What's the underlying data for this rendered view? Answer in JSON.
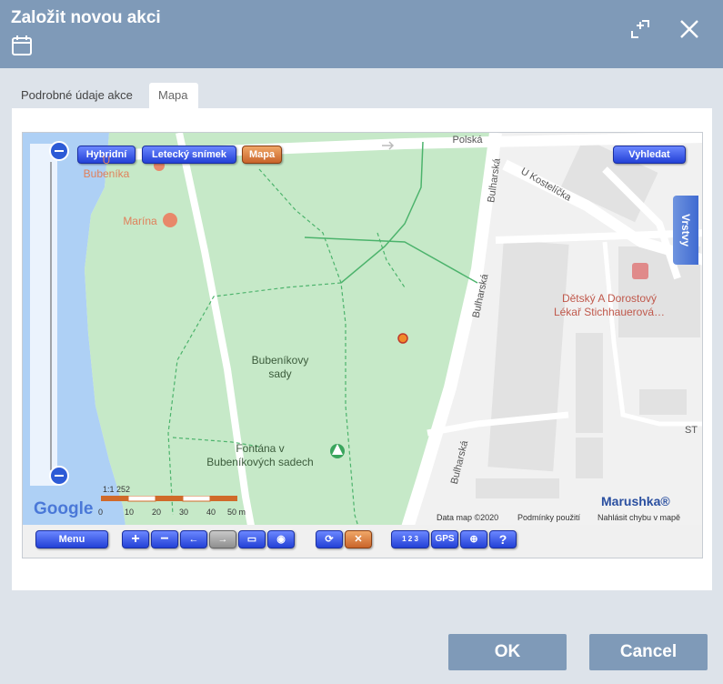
{
  "dialog": {
    "title": "Založit novou akci",
    "icons": [
      "calendar-icon",
      "expand-icon",
      "close-icon"
    ]
  },
  "tabs": [
    {
      "label": "Podrobné údaje akce",
      "active": false
    },
    {
      "label": "Mapa",
      "active": true
    }
  ],
  "map": {
    "top_buttons": {
      "hybrid": "Hybridní",
      "aerial": "Letecký snímek",
      "map": "Mapa"
    },
    "search_button": "Vyhledat",
    "layers_tab": "Vrstvy",
    "labels": {
      "park": "Bubeníkovy\nsady",
      "fountain": "Fontána v\nBubeníkových sadech",
      "marina": "Marína",
      "bubenika": "U Bubeníka",
      "doctor": "Dětský A Dorostový\nLékař Stichhauerová…",
      "polska": "Polská",
      "bulharska1": "Bulharská",
      "bulharska2": "Bulharská",
      "bulharska3": "Bulharská",
      "kostelicka": "U Kostelíčka",
      "st": "ST"
    },
    "scale": {
      "ratio": "1:1 252",
      "ticks": [
        "0",
        "10",
        "20",
        "30",
        "40",
        "50 m"
      ]
    },
    "attribution": {
      "google": "Google",
      "data": "Data map ©2020",
      "terms": "Podmínky použití",
      "report": "Nahlásit chybu v mapě",
      "brand": "Marushka®"
    },
    "toolbar": {
      "menu": "Menu",
      "gps": "GPS",
      "help": "?",
      "numbering": "1 2 3"
    },
    "colors": {
      "park": "#c6e9c8",
      "water": "#aed0f5",
      "roads": "#ffffff",
      "base": "#f1f1f1",
      "blocks": "#e2e2e2"
    }
  },
  "footer": {
    "ok": "OK",
    "cancel": "Cancel"
  }
}
